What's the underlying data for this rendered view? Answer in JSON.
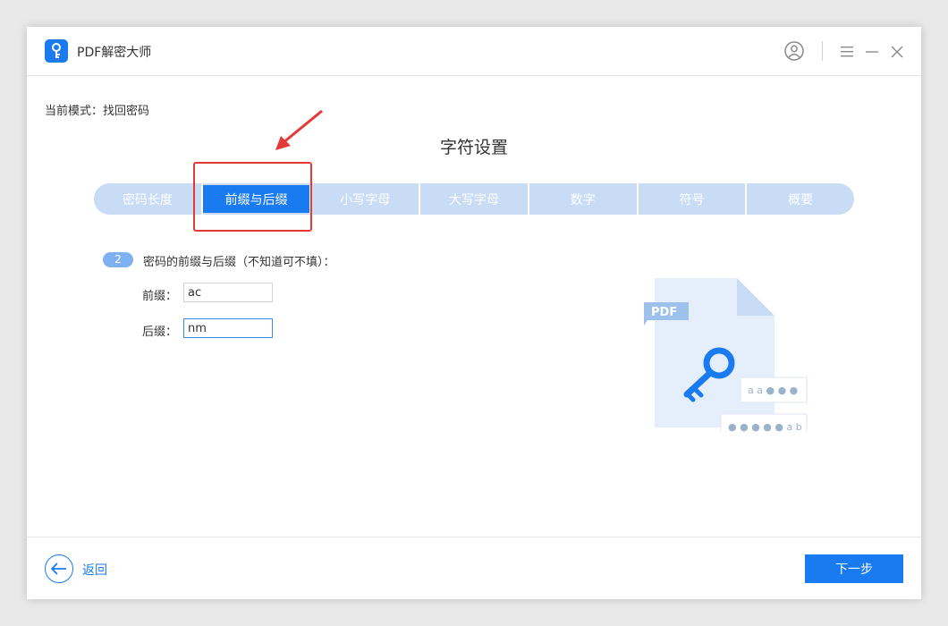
{
  "app": {
    "title": "PDF解密大师"
  },
  "mode": {
    "text": "当前模式：找回密码"
  },
  "section": {
    "title": "字符设置"
  },
  "steps": [
    {
      "label": "密码长度",
      "active": false
    },
    {
      "label": "前缀与后缀",
      "active": true
    },
    {
      "label": "小写字母",
      "active": false
    },
    {
      "label": "大写字母",
      "active": false
    },
    {
      "label": "数字",
      "active": false
    },
    {
      "label": "符号",
      "active": false
    },
    {
      "label": "概要",
      "active": false
    }
  ],
  "form": {
    "step_number": "2",
    "question": "密码的前缀与后缀（不知道可不填）：",
    "prefix_label": "前缀：",
    "prefix_value": "ac",
    "suffix_label": "后缀：",
    "suffix_value": "nm"
  },
  "illustration": {
    "doc_label": "PDF",
    "pattern_top": "a a ● ● ●",
    "pattern_bottom": "● ● ● ● ● a b"
  },
  "footer": {
    "back_label": "返回",
    "next_label": "下一步"
  },
  "colors": {
    "accent": "#1a7bf0",
    "step_bar": "#c8dcf6",
    "highlight": "#e53935"
  }
}
